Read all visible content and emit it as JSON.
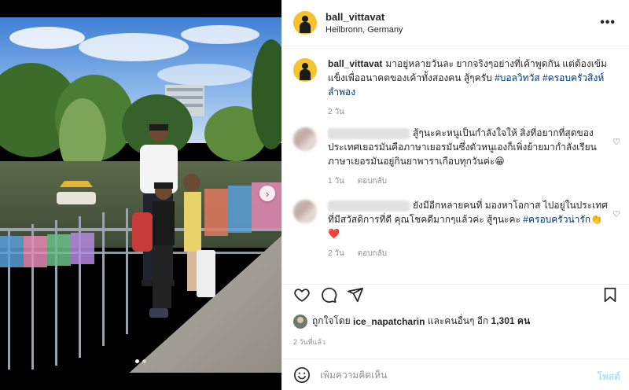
{
  "post": {
    "username": "ball_vittavat",
    "location": "Heilbronn, Germany",
    "more_icon": "more-icon"
  },
  "caption": {
    "username": "ball_vittavat",
    "text": "มาอยู่หลายวันละ ยากจริงๆอย่างที่เค้าพูดกัน แต่ต้องเข้มแข็งเพื่ออนาคตของเค้าทั้งสองคน สู้ๆครับ",
    "hashtags": "#บอลวิทวัส #ครอบครัวสิงห์ลำพอง",
    "time": "2 วัน"
  },
  "comments": [
    {
      "text": "สู้ๆนะคะหนูเป็นกำลังใจให้ สิ่งที่อยากที่สุดของประเทศเยอรมันคือภาษาเยอรมันซึ่งตัวหนูเองก็เพิ่งย้ายมากำลังเรียนภาษาเยอรมันอยู่กินยาพาราเกือบทุกวันค่ะ😁",
      "time": "1 วัน",
      "reply": "ตอบกลับ"
    },
    {
      "text": "ยังมีอีกหลายคนที่ มองหาโอกาส ไปอยู่ในประเทศที่มีสวัสดิการที่ดี คุณโชคดีมากๆแล้วค่ะ สู้ๆนะคะ",
      "hashtag": "#ครอบครัวน่ารัก",
      "emoji": "👏❤️",
      "time": "2 วัน",
      "reply": "ตอบกลับ"
    }
  ],
  "likes": {
    "prefix": "ถูกใจโดย",
    "user": "ice_napatcharin",
    "mid": "และคนอื่นๆ อีก",
    "count": "1,301 คน"
  },
  "time_ago": "2 วันที่แล้ว",
  "add_comment": {
    "placeholder": "เพิ่มความคิดเห็น",
    "post_label": "โพสต์"
  },
  "carousel": {
    "total": 2,
    "current": 1
  },
  "colors": {
    "link": "#00376b",
    "muted": "#8e8e8e",
    "post_disabled": "#b2dffc"
  }
}
